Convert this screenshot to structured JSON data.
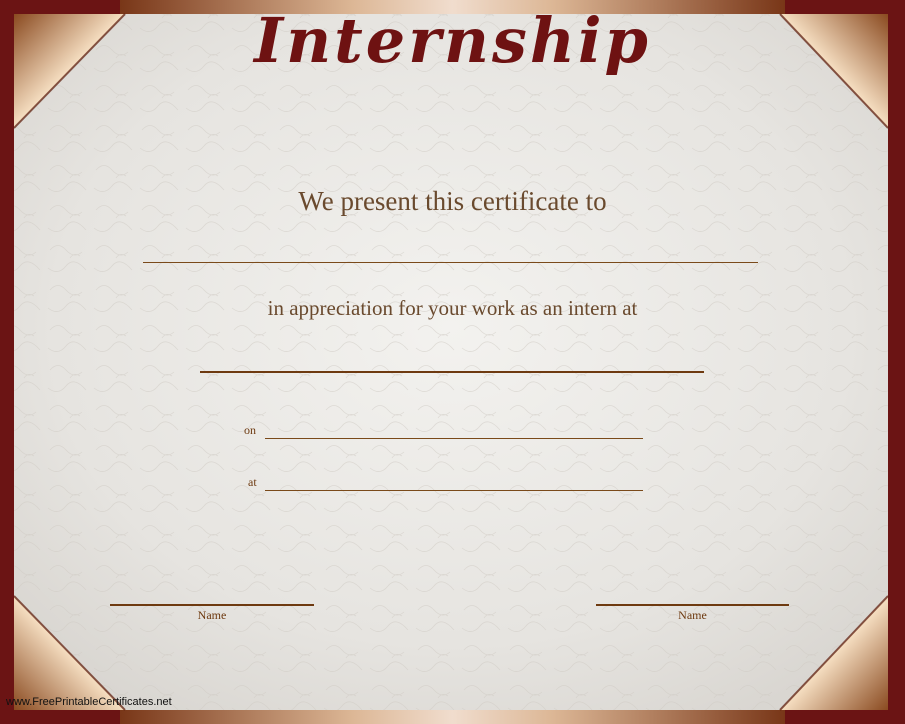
{
  "certificate": {
    "title": "Internship",
    "presentation_text": "We present this certificate to",
    "appreciation_text": "in appreciation for your work as an intern at",
    "on_label": "on",
    "at_label": "at",
    "left_signature_label": "Name",
    "right_signature_label": "Name"
  },
  "footer": {
    "website": "www.FreePrintableCertificates.net"
  },
  "colors": {
    "border": "#6b1414",
    "title": "#6e1212",
    "body_text": "#6a4a2e",
    "paper": "#ebe9e6",
    "gold": "#c89050"
  }
}
